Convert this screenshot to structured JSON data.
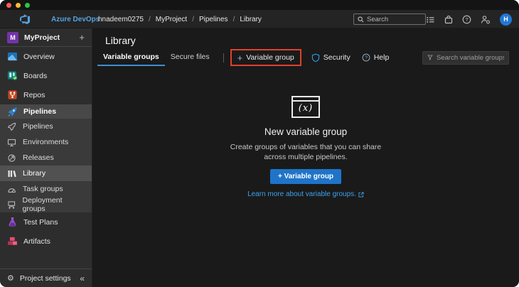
{
  "topbar": {
    "brand": "Azure DevOps",
    "breadcrumb": [
      "hnadeem0275",
      "MyProject",
      "Pipelines",
      "Library"
    ],
    "separator": "/",
    "search_placeholder": "Search",
    "avatar_initial": "H"
  },
  "sidebar": {
    "project_name": "MyProject",
    "project_initial": "M",
    "add_glyph": "+",
    "items": [
      {
        "label": "Overview"
      },
      {
        "label": "Boards"
      },
      {
        "label": "Repos"
      }
    ],
    "section": {
      "label": "Pipelines",
      "children": [
        {
          "label": "Pipelines"
        },
        {
          "label": "Environments"
        },
        {
          "label": "Releases"
        },
        {
          "label": "Library"
        },
        {
          "label": "Task groups"
        },
        {
          "label": "Deployment groups"
        }
      ]
    },
    "items_bottom": [
      {
        "label": "Test Plans"
      },
      {
        "label": "Artifacts"
      }
    ],
    "footer_label": "Project settings",
    "gear_glyph": "⚙",
    "collapse_glyph": "«"
  },
  "main": {
    "title": "Library",
    "tabs": [
      {
        "label": "Variable groups",
        "selected": true
      },
      {
        "label": "Secure files",
        "selected": false
      }
    ],
    "toolbar": {
      "plus_glyph": "+",
      "add_label": "Variable group",
      "security_label": "Security",
      "help_label": "Help"
    },
    "filter_placeholder": "Search variable groups",
    "empty": {
      "icon_text": "(x)",
      "title": "New variable group",
      "desc_line1": "Create groups of variables that you can share",
      "desc_line2": "across multiple pipelines.",
      "button_label": "+ Variable group",
      "link_label": "Learn more about variable groups."
    }
  },
  "colors": {
    "accent_blue": "#1f74c9",
    "tab_underline": "#3f8fd1",
    "link_blue": "#3ea2ed",
    "annotation_red": "#e0402c",
    "avatar_blue": "#2178d4",
    "traffic_red": "#ff5f57",
    "traffic_yellow": "#febc2e",
    "traffic_green": "#28c840"
  }
}
